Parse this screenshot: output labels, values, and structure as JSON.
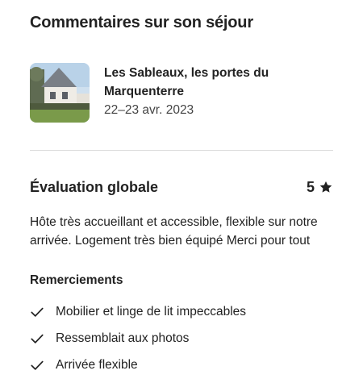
{
  "page": {
    "title": "Commentaires sur son séjour"
  },
  "listing": {
    "name": "Les Sableaux, les portes du Marquenterre",
    "dates": "22–23 avr. 2023"
  },
  "evaluation": {
    "title": "Évaluation globale",
    "rating": "5",
    "star_icon": "star-icon",
    "review": "Hôte très accueillant et accessible, flexible sur notre arrivée. Logement très bien équipé Merci pour tout"
  },
  "thanks": {
    "title": "Remerciements",
    "items": [
      {
        "label": "Mobilier et linge de lit impeccables",
        "icon": "check-icon"
      },
      {
        "label": "Ressemblait aux photos",
        "icon": "check-icon"
      },
      {
        "label": "Arrivée flexible",
        "icon": "check-icon"
      }
    ]
  },
  "colors": {
    "text": "#222222",
    "divider": "#dddddd"
  }
}
